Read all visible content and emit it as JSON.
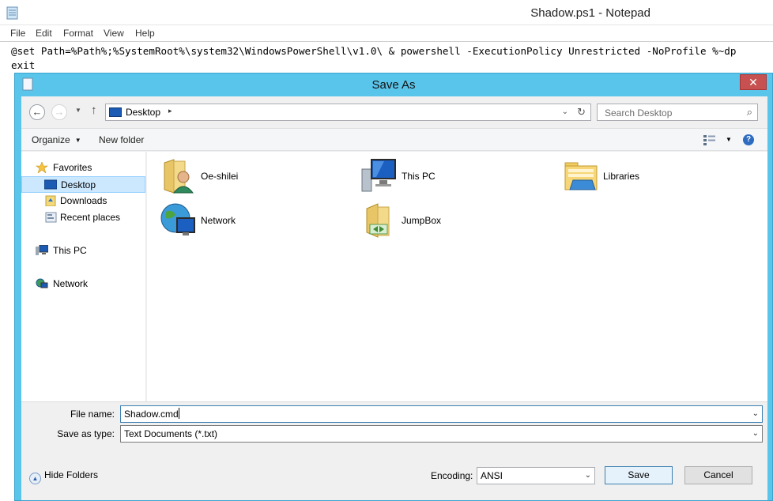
{
  "notepad": {
    "title": "Shadow.ps1 - Notepad",
    "menu": [
      "File",
      "Edit",
      "Format",
      "View",
      "Help"
    ],
    "line1": "@set Path=%Path%;%SystemRoot%\\system32\\WindowsPowerShell\\v1.0\\ & powershell -ExecutionPolicy Unrestricted -NoProfile %~dp",
    "line2": "exit"
  },
  "dialog": {
    "title": "Save As",
    "close": "✕",
    "address": {
      "location": "Desktop",
      "separator": "▸"
    },
    "search_placeholder": "Search Desktop",
    "commands": {
      "organize": "Organize",
      "new_folder": "New folder"
    },
    "nav": {
      "favorites": "Favorites",
      "desktop": "Desktop",
      "downloads": "Downloads",
      "recent": "Recent places",
      "this_pc": "This PC",
      "network": "Network"
    },
    "items": [
      {
        "label": "Oe-shilei",
        "icon": "user-folder-icon"
      },
      {
        "label": "This PC",
        "icon": "computer-icon"
      },
      {
        "label": "Libraries",
        "icon": "libraries-icon"
      },
      {
        "label": "Network",
        "icon": "network-icon"
      },
      {
        "label": "JumpBox",
        "icon": "shortcut-folder-icon"
      }
    ],
    "form": {
      "file_name_label": "File name:",
      "file_name": "Shadow.cmd",
      "save_type_label": "Save as type:",
      "save_type": "Text Documents (*.txt)",
      "hide_folders": "Hide Folders",
      "encoding_label": "Encoding:",
      "encoding": "ANSI",
      "save": "Save",
      "cancel": "Cancel"
    }
  },
  "colors": {
    "dialog_frame": "#5ac5ea",
    "close": "#c75050",
    "selection": "#cce8ff"
  }
}
